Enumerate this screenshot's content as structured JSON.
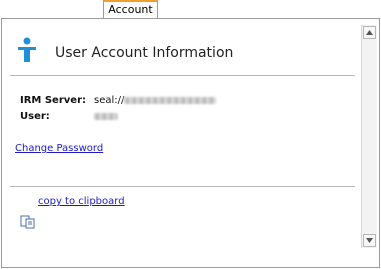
{
  "tab": {
    "label": "Account"
  },
  "header": {
    "title": "User Account Information",
    "icon": "user-info-icon",
    "icon_color": "#1e8fd8"
  },
  "fields": {
    "server_label": "IRM Server:",
    "server_prefix": "seal://",
    "user_label": "User:"
  },
  "links": {
    "change_password": "Change Password",
    "copy_clipboard": "copy to clipboard"
  },
  "colors": {
    "tab_accent": "#f0a030",
    "link": "#1a1ac8"
  }
}
